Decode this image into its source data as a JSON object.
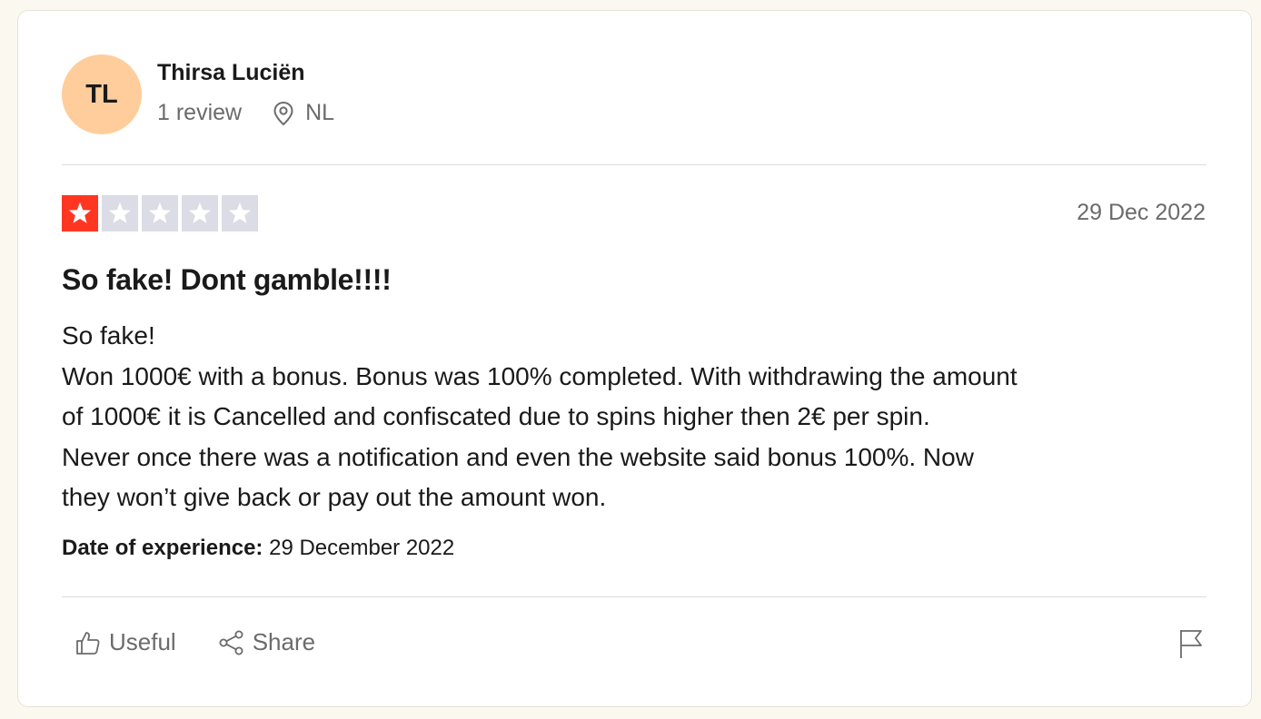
{
  "review": {
    "author": {
      "initials": "TL",
      "name": "Thirsa Luciën",
      "review_count": "1 review",
      "country": "NL",
      "avatar_color": "#ffcd9b"
    },
    "rating": {
      "value": 1,
      "max": 5,
      "active_color": "#ff3722",
      "inactive_color": "#dcdce6"
    },
    "date": "29 Dec 2022",
    "title": "So fake! Dont gamble!!!!",
    "body_lines": [
      "So fake!",
      "Won 1000€ with a bonus. Bonus was 100% completed. With withdrawing the amount",
      "of 1000€ it is Cancelled and confiscated due to spins higher then 2€ per spin.",
      "Never once there was a notification and even the website said bonus 100%. Now",
      "they won’t give back or pay out the amount won."
    ],
    "experience": {
      "label": "Date of experience:",
      "value": " 29 December 2022"
    },
    "actions": {
      "useful_label": "Useful",
      "useful_icon": "thumbs-up-icon",
      "share_label": "Share",
      "share_icon": "share-icon",
      "report_icon": "flag-icon"
    }
  }
}
